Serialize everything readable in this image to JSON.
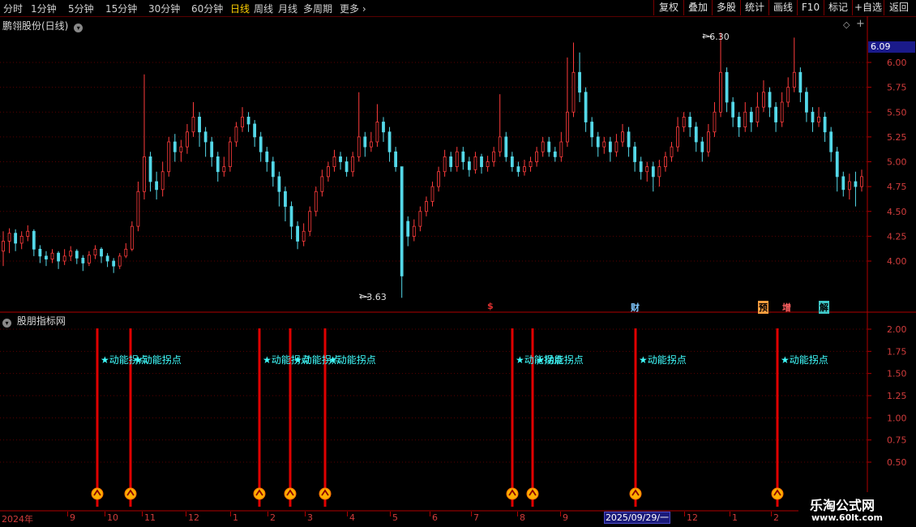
{
  "toolbar": {
    "periods": [
      "分时",
      "1分钟",
      "5分钟",
      "15分钟",
      "30分钟",
      "60分钟",
      "日线",
      "周线",
      "月线",
      "多周期",
      "更多"
    ],
    "active_period": "日线",
    "tools": [
      "复权",
      "叠加",
      "多股",
      "统计",
      "画线",
      "F10",
      "标记",
      "+自选",
      "返回"
    ]
  },
  "main_pane": {
    "title": "鹏翎股份(日线)",
    "current_price": "6.09",
    "high_label": "6.30",
    "low_label": "3.63",
    "tags": [
      {
        "text": "$",
        "color": "#e03030"
      },
      {
        "text": "财",
        "color": "#80c8ff"
      },
      {
        "text": "预",
        "color": "#ffa040"
      },
      {
        "text": "增",
        "color": "#ff6060"
      },
      {
        "text": "解",
        "color": "#40e0e0"
      }
    ],
    "yticks": [
      "6.00",
      "5.75",
      "5.50",
      "5.25",
      "5.00",
      "4.75",
      "4.50",
      "4.25",
      "4.00"
    ]
  },
  "indicator_pane": {
    "title": "股朋指标网",
    "yticks": [
      "2.00",
      "1.75",
      "1.50",
      "1.25",
      "1.00",
      "0.75",
      "0.50"
    ],
    "signal_label": "★动能拐点",
    "signal_color": "#e00000",
    "label_color": "#40ffff"
  },
  "time_axis": {
    "labels": [
      "2024年",
      "9",
      "10",
      "11",
      "12",
      "1",
      "2",
      "3",
      "4",
      "5",
      "6",
      "7",
      "8",
      "9",
      "2025/09/29/一",
      "12",
      "1",
      "2"
    ],
    "cursor_date": "2025/09/29/一"
  },
  "watermark": {
    "name": "乐淘公式网",
    "url": "www.60lt.com"
  },
  "chart_data": {
    "type": "candlestick",
    "ylim": [
      3.6,
      6.3
    ],
    "up_color": "#ff3c3c",
    "down_color": "#54d8e8",
    "candles": [
      [
        4.1,
        4.2,
        4.3,
        3.95
      ],
      [
        4.2,
        4.28,
        4.33,
        4.08
      ],
      [
        4.28,
        4.18,
        4.32,
        4.1
      ],
      [
        4.18,
        4.25,
        4.3,
        4.12
      ],
      [
        4.25,
        4.3,
        4.36,
        4.2
      ],
      [
        4.3,
        4.12,
        4.32,
        4.05
      ],
      [
        4.12,
        4.05,
        4.16,
        3.98
      ],
      [
        4.05,
        4.02,
        4.1,
        3.95
      ],
      [
        4.02,
        4.08,
        4.12,
        3.98
      ],
      [
        4.08,
        4.0,
        4.1,
        3.92
      ],
      [
        4.0,
        4.05,
        4.12,
        3.96
      ],
      [
        4.05,
        4.1,
        4.15,
        4.0
      ],
      [
        4.1,
        4.03,
        4.12,
        3.97
      ],
      [
        4.03,
        3.98,
        4.06,
        3.9
      ],
      [
        3.98,
        4.06,
        4.1,
        3.95
      ],
      [
        4.06,
        4.12,
        4.16,
        4.02
      ],
      [
        4.12,
        4.05,
        4.14,
        3.98
      ],
      [
        4.05,
        4.0,
        4.08,
        3.94
      ],
      [
        4.0,
        3.95,
        4.03,
        3.88
      ],
      [
        3.95,
        4.05,
        4.08,
        3.92
      ],
      [
        4.05,
        4.12,
        4.18,
        4.03
      ],
      [
        4.12,
        4.35,
        4.4,
        4.1
      ],
      [
        4.35,
        4.7,
        4.8,
        4.3
      ],
      [
        4.7,
        5.05,
        5.88,
        4.62
      ],
      [
        5.05,
        4.8,
        5.1,
        4.7
      ],
      [
        4.8,
        4.72,
        4.9,
        4.62
      ],
      [
        4.72,
        4.9,
        5.0,
        4.65
      ],
      [
        4.9,
        5.2,
        5.25,
        4.85
      ],
      [
        5.2,
        5.1,
        5.28,
        5.0
      ],
      [
        5.1,
        5.15,
        5.22,
        5.0
      ],
      [
        5.15,
        5.3,
        5.38,
        5.08
      ],
      [
        5.3,
        5.45,
        5.6,
        5.25
      ],
      [
        5.45,
        5.3,
        5.5,
        5.15
      ],
      [
        5.3,
        5.2,
        5.35,
        5.05
      ],
      [
        5.2,
        5.05,
        5.25,
        4.95
      ],
      [
        5.05,
        4.9,
        5.1,
        4.8
      ],
      [
        4.9,
        4.95,
        5.05,
        4.85
      ],
      [
        4.95,
        5.2,
        5.25,
        4.9
      ],
      [
        5.2,
        5.35,
        5.4,
        5.15
      ],
      [
        5.35,
        5.45,
        5.55,
        5.3
      ],
      [
        5.45,
        5.38,
        5.5,
        5.3
      ],
      [
        5.38,
        5.25,
        5.42,
        5.15
      ],
      [
        5.25,
        5.1,
        5.3,
        5.0
      ],
      [
        5.1,
        5.0,
        5.15,
        4.9
      ],
      [
        5.0,
        4.85,
        5.05,
        4.75
      ],
      [
        4.85,
        4.7,
        4.9,
        4.55
      ],
      [
        4.7,
        4.55,
        4.75,
        4.4
      ],
      [
        4.55,
        4.35,
        4.6,
        4.22
      ],
      [
        4.35,
        4.2,
        4.4,
        4.12
      ],
      [
        4.2,
        4.3,
        4.38,
        4.15
      ],
      [
        4.3,
        4.5,
        4.55,
        4.25
      ],
      [
        4.5,
        4.7,
        4.75,
        4.45
      ],
      [
        4.7,
        4.85,
        4.92,
        4.65
      ],
      [
        4.85,
        4.95,
        5.0,
        4.8
      ],
      [
        4.95,
        5.05,
        5.12,
        4.9
      ],
      [
        5.05,
        5.0,
        5.1,
        4.92
      ],
      [
        5.0,
        4.9,
        5.05,
        4.85
      ],
      [
        4.9,
        5.05,
        5.1,
        4.85
      ],
      [
        5.05,
        5.25,
        5.7,
        5.0
      ],
      [
        5.25,
        5.15,
        5.3,
        5.05
      ],
      [
        5.15,
        5.2,
        5.3,
        5.1
      ],
      [
        5.2,
        5.4,
        5.58,
        5.15
      ],
      [
        5.4,
        5.3,
        5.45,
        5.2
      ],
      [
        5.3,
        5.1,
        5.35,
        5.0
      ],
      [
        5.1,
        4.95,
        5.15,
        4.9
      ],
      [
        4.95,
        3.85,
        4.55,
        3.63
      ],
      [
        4.4,
        4.25,
        4.45,
        4.15
      ],
      [
        4.25,
        4.35,
        4.42,
        4.2
      ],
      [
        4.35,
        4.5,
        4.55,
        4.3
      ],
      [
        4.5,
        4.6,
        4.65,
        4.45
      ],
      [
        4.6,
        4.75,
        4.8,
        4.55
      ],
      [
        4.75,
        4.9,
        4.95,
        4.7
      ],
      [
        4.9,
        5.05,
        5.12,
        4.85
      ],
      [
        5.05,
        4.95,
        5.1,
        4.9
      ],
      [
        4.95,
        5.1,
        5.15,
        4.9
      ],
      [
        5.1,
        5.0,
        5.15,
        4.92
      ],
      [
        5.0,
        4.92,
        5.05,
        4.85
      ],
      [
        4.92,
        5.05,
        5.1,
        4.88
      ],
      [
        5.05,
        4.95,
        5.08,
        4.88
      ],
      [
        4.95,
        5.0,
        5.06,
        4.9
      ],
      [
        5.0,
        5.1,
        5.15,
        4.95
      ],
      [
        5.1,
        5.25,
        5.68,
        5.05
      ],
      [
        5.25,
        5.05,
        5.3,
        5.0
      ],
      [
        5.05,
        4.95,
        5.1,
        4.9
      ],
      [
        4.95,
        4.9,
        5.0,
        4.85
      ],
      [
        4.9,
        4.95,
        5.02,
        4.86
      ],
      [
        4.95,
        5.0,
        5.05,
        4.9
      ],
      [
        5.0,
        5.1,
        5.15,
        4.95
      ],
      [
        5.1,
        5.2,
        5.25,
        5.05
      ],
      [
        5.2,
        5.1,
        5.25,
        5.05
      ],
      [
        5.1,
        5.05,
        5.15,
        5.0
      ],
      [
        5.05,
        5.2,
        5.3,
        5.0
      ],
      [
        5.2,
        5.5,
        6.05,
        5.15
      ],
      [
        5.5,
        5.9,
        6.2,
        5.45
      ],
      [
        5.9,
        5.7,
        6.1,
        5.6
      ],
      [
        5.7,
        5.4,
        5.75,
        5.3
      ],
      [
        5.4,
        5.25,
        5.45,
        5.15
      ],
      [
        5.25,
        5.15,
        5.3,
        5.05
      ],
      [
        5.15,
        5.2,
        5.25,
        5.08
      ],
      [
        5.2,
        5.1,
        5.25,
        5.0
      ],
      [
        5.1,
        5.2,
        5.28,
        5.05
      ],
      [
        5.2,
        5.3,
        5.38,
        5.15
      ],
      [
        5.3,
        5.15,
        5.35,
        5.05
      ],
      [
        5.15,
        5.0,
        5.2,
        4.9
      ],
      [
        5.0,
        4.9,
        5.05,
        4.82
      ],
      [
        4.9,
        4.95,
        5.0,
        4.8
      ],
      [
        4.95,
        4.85,
        5.0,
        4.7
      ],
      [
        4.85,
        4.95,
        5.02,
        4.75
      ],
      [
        4.95,
        5.05,
        5.1,
        4.9
      ],
      [
        5.05,
        5.15,
        5.2,
        5.0
      ],
      [
        5.15,
        5.35,
        5.45,
        5.1
      ],
      [
        5.35,
        5.45,
        5.5,
        5.3
      ],
      [
        5.45,
        5.35,
        5.5,
        5.25
      ],
      [
        5.35,
        5.2,
        5.4,
        5.1
      ],
      [
        5.2,
        5.1,
        5.25,
        5.0
      ],
      [
        5.1,
        5.3,
        5.38,
        5.05
      ],
      [
        5.3,
        5.5,
        5.6,
        5.25
      ],
      [
        5.5,
        5.9,
        6.3,
        5.45
      ],
      [
        5.9,
        5.6,
        5.95,
        5.5
      ],
      [
        5.6,
        5.45,
        5.65,
        5.35
      ],
      [
        5.45,
        5.35,
        5.5,
        5.25
      ],
      [
        5.35,
        5.5,
        5.6,
        5.3
      ],
      [
        5.5,
        5.4,
        5.55,
        5.3
      ],
      [
        5.4,
        5.55,
        5.7,
        5.35
      ],
      [
        5.55,
        5.7,
        5.82,
        5.5
      ],
      [
        5.7,
        5.55,
        5.75,
        5.45
      ],
      [
        5.55,
        5.4,
        5.6,
        5.3
      ],
      [
        5.4,
        5.6,
        5.7,
        5.35
      ],
      [
        5.6,
        5.75,
        5.85,
        5.55
      ],
      [
        5.75,
        5.9,
        6.25,
        5.7
      ],
      [
        5.9,
        5.7,
        5.95,
        5.6
      ],
      [
        5.7,
        5.5,
        5.75,
        5.4
      ],
      [
        5.5,
        5.4,
        5.55,
        5.3
      ],
      [
        5.4,
        5.45,
        5.55,
        5.35
      ],
      [
        5.45,
        5.3,
        5.5,
        5.2
      ],
      [
        5.3,
        5.1,
        5.35,
        5.0
      ],
      [
        5.1,
        4.85,
        5.15,
        4.7
      ],
      [
        4.85,
        4.72,
        4.9,
        4.65
      ],
      [
        4.72,
        4.8,
        4.88,
        4.62
      ],
      [
        4.8,
        4.75,
        4.9,
        4.55
      ],
      [
        4.75,
        4.85,
        4.92,
        4.7
      ]
    ],
    "signal_candle_indices": [
      11,
      19,
      48,
      55,
      63,
      118,
      123,
      146,
      178
    ],
    "signals": [
      {
        "x_pos": 120
      },
      {
        "x_pos": 161
      },
      {
        "x_pos": 320
      },
      {
        "x_pos": 358
      },
      {
        "x_pos": 401
      },
      {
        "x_pos": 632
      },
      {
        "x_pos": 657
      },
      {
        "x_pos": 784
      },
      {
        "x_pos": 959
      }
    ]
  }
}
